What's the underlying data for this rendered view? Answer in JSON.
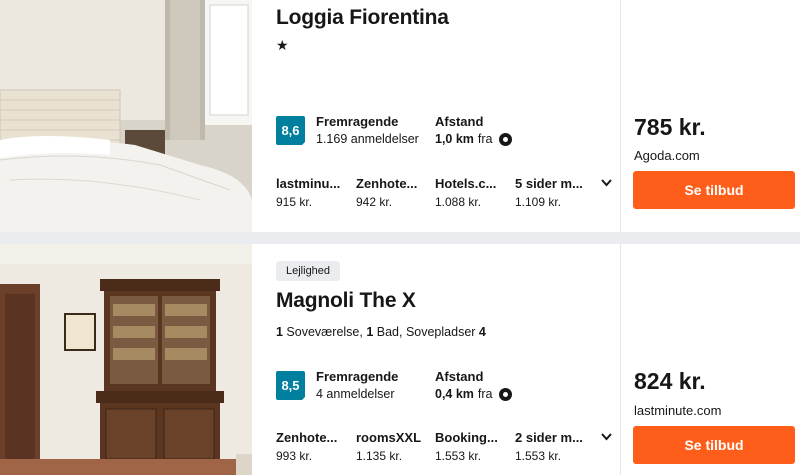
{
  "results": [
    {
      "name": "Loggia Fiorentina",
      "stars": "★",
      "rating": {
        "score": "8,6",
        "label": "Fremragende",
        "count": "1.169 anmeldelser"
      },
      "distance": {
        "label": "Afstand",
        "value": "1,0 km",
        "suffix": "fra"
      },
      "providers": [
        {
          "name": "lastminu...",
          "price": "915 kr."
        },
        {
          "name": "Zenhote...",
          "price": "942 kr."
        },
        {
          "name": "Hotels.c...",
          "price": "1.088 kr."
        },
        {
          "name": "5 sider m...",
          "price": "1.109 kr."
        }
      ],
      "price": "785 kr.",
      "site": "Agoda.com",
      "cta": "Se tilbud"
    },
    {
      "badge": "Lejlighed",
      "name": "Magnoli The X",
      "details": {
        "n1": "1",
        "t1": " Soveværelse, ",
        "n2": "1",
        "t2": " Bad, Sovepladser ",
        "n3": "4"
      },
      "rating": {
        "score": "8,5",
        "label": "Fremragende",
        "count": "4 anmeldelser"
      },
      "distance": {
        "label": "Afstand",
        "value": "0,4 km",
        "suffix": "fra"
      },
      "providers": [
        {
          "name": "Zenhote...",
          "price": "993 kr."
        },
        {
          "name": "roomsXXL",
          "price": "1.135 kr."
        },
        {
          "name": "Booking...",
          "price": "1.553 kr."
        },
        {
          "name": "2 sider m...",
          "price": "1.553 kr."
        }
      ],
      "price": "824 kr.",
      "site": "lastminute.com",
      "cta": "Se tilbud"
    }
  ],
  "icons": {
    "pin": "map-pin-icon",
    "chevron": "chevron-down-icon"
  },
  "colors": {
    "rating": "#007f9e",
    "cta": "#ff5e1a",
    "background": "#ebecf0"
  }
}
